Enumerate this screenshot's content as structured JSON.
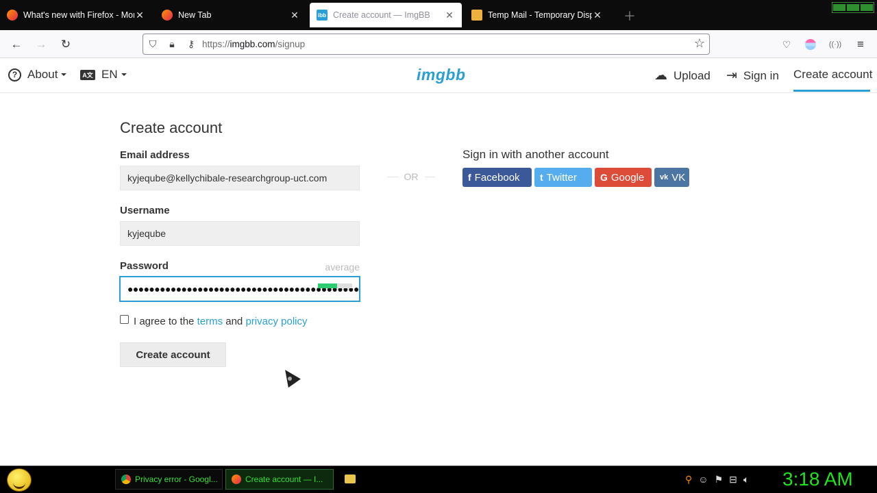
{
  "browser": {
    "tabs": [
      {
        "title": "What's new with Firefox - More",
        "favicon": "firefox-icon",
        "active": false
      },
      {
        "title": "New Tab",
        "favicon": "firefox-icon",
        "active": false
      },
      {
        "title": "Create account — ImgBB",
        "favicon": "imgbb-icon",
        "active": true
      },
      {
        "title": "Temp Mail - Temporary Dispos",
        "favicon": "tempmail-icon",
        "active": false
      }
    ],
    "url_scheme": "https://",
    "url_host": "imgbb.com",
    "url_path": "/signup"
  },
  "site": {
    "logo": "imgbb",
    "about_label": "About",
    "lang_label": "EN",
    "lang_icon_text": "A文",
    "upload_label": "Upload",
    "signin_label": "Sign in",
    "create_label": "Create account"
  },
  "form": {
    "title": "Create account",
    "email_label": "Email address",
    "email_value": "kyjeqube@kellychibale-researchgroup-uct.com",
    "username_label": "Username",
    "username_value": "kyjeqube",
    "password_label": "Password",
    "password_strength": "average",
    "password_dots": "●●●●●●●●●●●●●●●●●●●●●●●●●●●●●●●●●●●●●●●●●●●●",
    "agree_prefix": "I agree to the",
    "terms_link": "terms",
    "agree_and": "and",
    "privacy_link": "privacy policy",
    "submit_label": "Create account",
    "or_label": "OR",
    "strength_fill": 0.55
  },
  "social": {
    "title": "Sign in with another account",
    "buttons": [
      {
        "label": "Facebook",
        "icon": "f",
        "color": "#3b5998"
      },
      {
        "label": "Twitter",
        "icon": "t",
        "color": "#55acee"
      },
      {
        "label": "Google",
        "icon": "G",
        "color": "#dd4b39"
      },
      {
        "label": "VK",
        "icon": "vk",
        "color": "#4c75a3"
      }
    ]
  },
  "taskbar": {
    "tasks": [
      {
        "title": "Privacy error - Googl...",
        "active": false
      },
      {
        "title": "Create account — I...",
        "active": true
      }
    ],
    "clock": "3:18 AM"
  }
}
